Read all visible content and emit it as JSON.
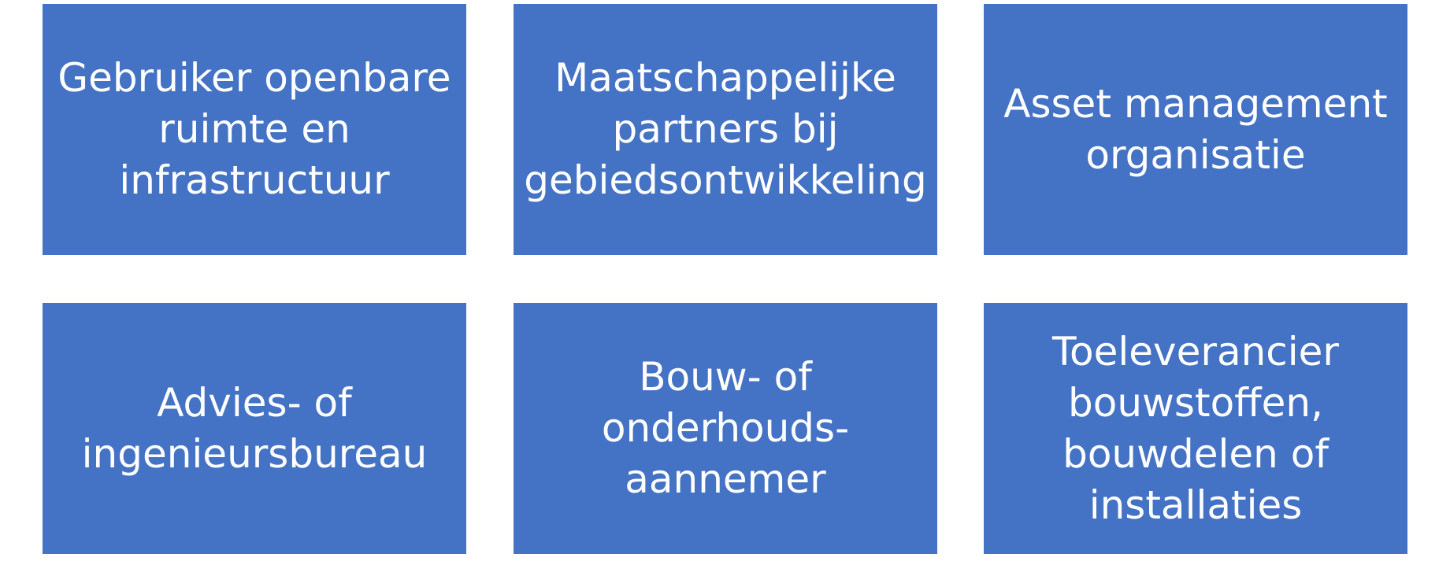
{
  "tiles": [
    {
      "label": "Gebruiker openbare\nruimte en\ninfrastructuur"
    },
    {
      "label": "Maatschappelijke\npartners bij\ngebiedsontwikkeling"
    },
    {
      "label": "Asset management\norganisatie"
    },
    {
      "label": "Advies- of\ningenieursbureau"
    },
    {
      "label": "Bouw- of\nonderhouds-\naannemer"
    },
    {
      "label": "Toeleverancier\nbouwstoffen,\nbouwdelen of\ninstallaties"
    }
  ],
  "colors": {
    "tile_fill": "#4472C4",
    "tile_text": "#FFFFFF",
    "background": "#FFFFFF"
  }
}
